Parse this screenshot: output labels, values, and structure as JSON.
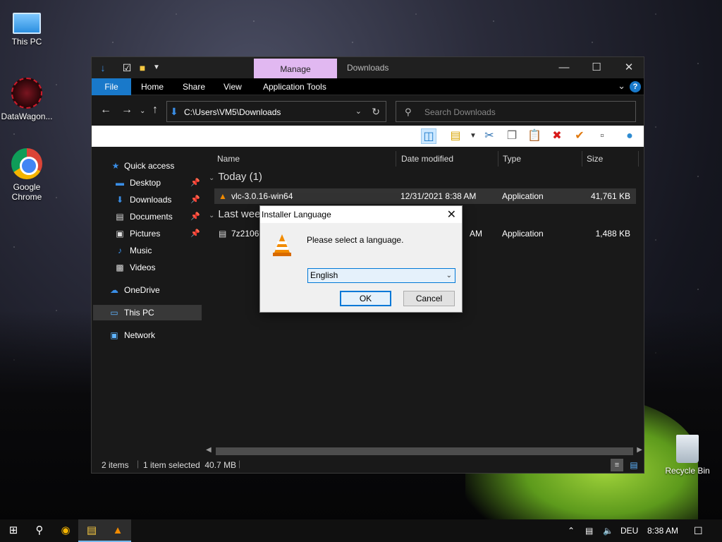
{
  "desktop": {
    "icons": [
      {
        "label": "This PC"
      },
      {
        "label": "DataWagon..."
      },
      {
        "label": "Google Chrome"
      },
      {
        "label": "Recycle Bin"
      }
    ]
  },
  "explorer": {
    "title": "Downloads",
    "manage_tab": "Manage",
    "ribbon_tabs": [
      "File",
      "Home",
      "Share",
      "View",
      "Application Tools"
    ],
    "address": "C:\\Users\\VM5\\Downloads",
    "search_placeholder": "Search Downloads",
    "sidebar": {
      "items": [
        {
          "label": "Quick access"
        },
        {
          "label": "Desktop"
        },
        {
          "label": "Downloads"
        },
        {
          "label": "Documents"
        },
        {
          "label": "Pictures"
        },
        {
          "label": "Music"
        },
        {
          "label": "Videos"
        },
        {
          "label": "OneDrive"
        },
        {
          "label": "This PC"
        },
        {
          "label": "Network"
        }
      ]
    },
    "columns": [
      "Name",
      "Date modified",
      "Type",
      "Size"
    ],
    "groups": [
      {
        "label": "Today (1)"
      },
      {
        "label": "Last week (1)"
      }
    ],
    "files": [
      {
        "name": "vlc-3.0.16-win64",
        "date": "12/31/2021 8:38 AM",
        "type": "Application",
        "size": "41,761 KB"
      },
      {
        "name": "7z2106-x64",
        "date": "AM",
        "type": "Application",
        "size": "1,488 KB"
      }
    ],
    "status": {
      "items": "2 items",
      "selected": "1 item selected  40.7 MB"
    }
  },
  "dialog": {
    "title": "Installer Language",
    "message": "Please select a language.",
    "selected_language": "English",
    "ok_label": "OK",
    "cancel_label": "Cancel"
  },
  "taskbar": {
    "language": "DEU",
    "time": "8:38 AM"
  },
  "colors": {
    "accent": "#1979ca",
    "manage_tab": "#e1b8f1",
    "dialog_focus": "#0078d7"
  }
}
